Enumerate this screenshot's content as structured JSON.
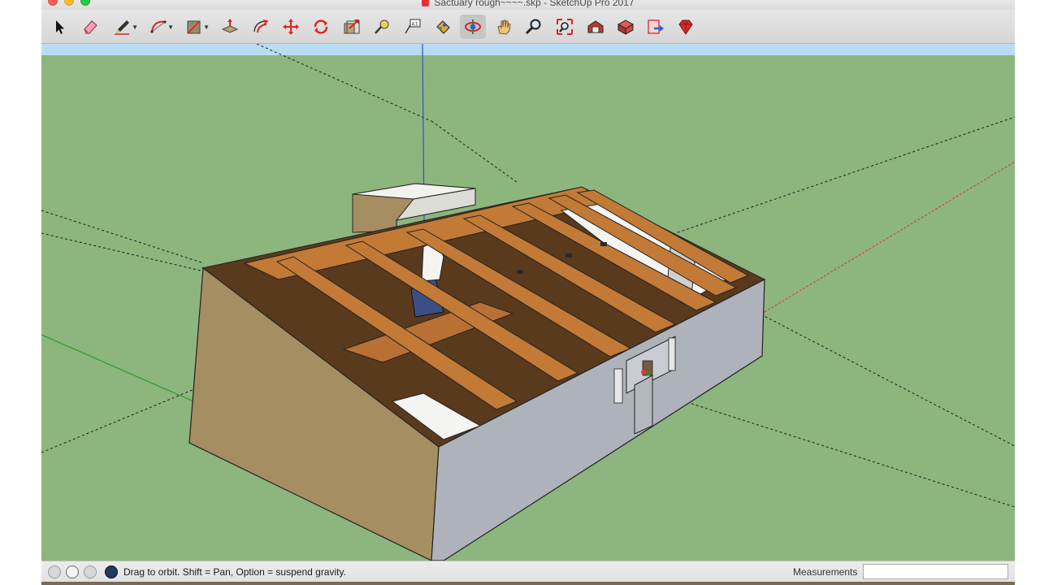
{
  "window": {
    "title": "Sactuary rough~~~~.skp - SketchUp Pro 2017"
  },
  "toolbar": {
    "tools": [
      {
        "name": "select-tool",
        "icon": "arrow-pointer-icon"
      },
      {
        "name": "eraser-tool",
        "icon": "eraser-icon"
      },
      {
        "name": "pencil-tool",
        "icon": "pencil-icon"
      },
      {
        "name": "arc-tool",
        "icon": "arc-icon"
      },
      {
        "name": "shape-tool",
        "icon": "rectangle-icon"
      },
      {
        "name": "push-pull-tool",
        "icon": "push-pull-icon"
      },
      {
        "name": "offset-tool",
        "icon": "offset-icon"
      },
      {
        "name": "move-tool",
        "icon": "move-arrows-icon"
      },
      {
        "name": "rotate-tool",
        "icon": "rotate-icon"
      },
      {
        "name": "scale-tool",
        "icon": "scale-icon"
      },
      {
        "name": "tape-measure-tool",
        "icon": "tape-measure-icon"
      },
      {
        "name": "text-tool",
        "icon": "text-label-icon"
      },
      {
        "name": "paint-bucket-tool",
        "icon": "paint-bucket-icon"
      },
      {
        "name": "orbit-tool",
        "icon": "orbit-icon"
      },
      {
        "name": "pan-tool",
        "icon": "hand-icon"
      },
      {
        "name": "zoom-tool",
        "icon": "magnifier-icon"
      },
      {
        "name": "zoom-extents-tool",
        "icon": "zoom-extents-icon"
      },
      {
        "name": "3d-warehouse-tool",
        "icon": "warehouse-icon"
      },
      {
        "name": "extension-warehouse-tool",
        "icon": "extension-box-icon"
      },
      {
        "name": "send-to-layout-tool",
        "icon": "layout-icon"
      },
      {
        "name": "extension-manager-tool",
        "icon": "ruby-gem-icon"
      }
    ]
  },
  "status": {
    "message": "Drag to orbit. Shift = Pan, Option = suspend gravity.",
    "measurements_label": "Measurements",
    "measurements_value": ""
  },
  "colors": {
    "ground": "#8db57e",
    "sky": "#b9dcf2",
    "wood": "#c27a36",
    "wall_tan": "#a58e62",
    "wall_gray": "#aeb3bb",
    "accent_red": "#d9393b"
  }
}
